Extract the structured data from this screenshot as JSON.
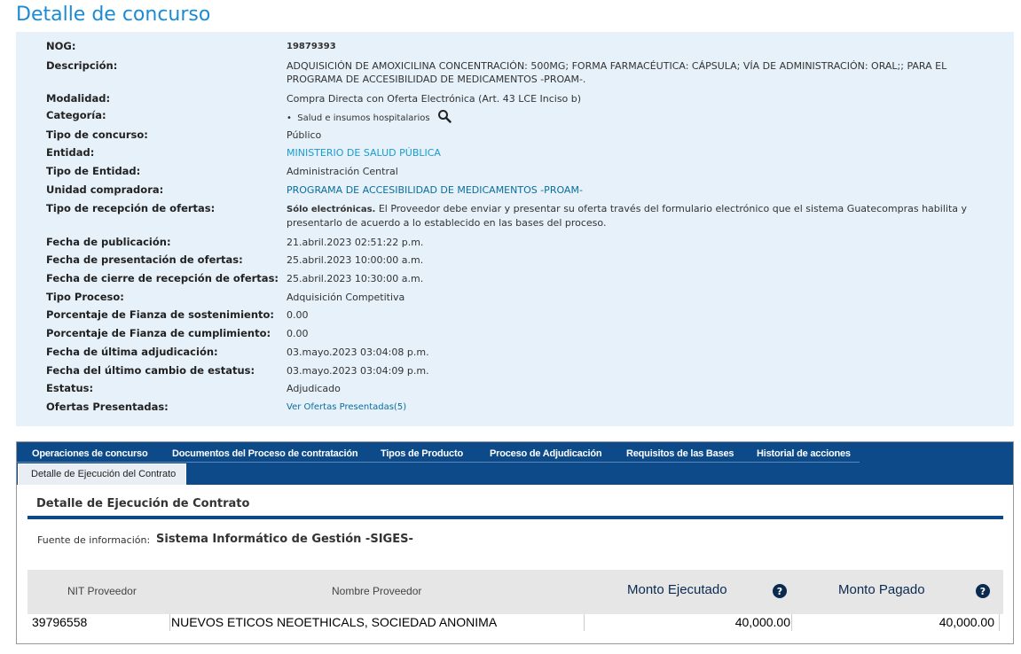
{
  "page_title": "Detalle de concurso",
  "details": [
    {
      "label": "NOG:",
      "value": "19879393"
    },
    {
      "label": "Descripción:",
      "value": "ADQUISICIÓN DE AMOXICILINA CONCENTRACIÓN: 500MG; FORMA FARMACÉUTICA: CÁPSULA; VÍA DE ADMINISTRACIÓN: ORAL;; PARA EL PROGRAMA DE ACCESIBILIDAD DE MEDICAMENTOS -PROAM-."
    },
    {
      "label": "Modalidad:",
      "value": "Compra Directa con Oferta Electrónica (Art. 43 LCE Inciso b)"
    },
    {
      "label": "Categoría:",
      "value": "Salud e insumos hospitalarios"
    },
    {
      "label": "Tipo de concurso:",
      "value": "Público"
    },
    {
      "label": "Entidad:",
      "value": "MINISTERIO DE SALUD PÚBLICA"
    },
    {
      "label": "Tipo de Entidad:",
      "value": "Administración Central"
    },
    {
      "label": "Unidad compradora:",
      "value": "PROGRAMA DE ACCESIBILIDAD DE MEDICAMENTOS -PROAM-"
    },
    {
      "label": "Tipo de recepción de ofertas:",
      "value_lead": "Sólo electrónicas.",
      "value": " El Proveedor debe enviar y presentar su oferta través del formulario electrónico que el sistema Guatecompras habilita y presentarlo de acuerdo a lo establecido en las bases del proceso."
    },
    {
      "label": "Fecha de publicación:",
      "value": "21.abril.2023 02:51:22 p.m."
    },
    {
      "label": "Fecha de presentación de ofertas:",
      "value": "25.abril.2023 10:00:00 a.m."
    },
    {
      "label": "Fecha de cierre de recepción de ofertas:",
      "value": "25.abril.2023 10:30:00 a.m."
    },
    {
      "label": "Tipo Proceso:",
      "value": "Adquisición Competitiva"
    },
    {
      "label": "Porcentaje de Fianza de sostenimiento:",
      "value": "0.00"
    },
    {
      "label": "Porcentaje de Fianza de cumplimiento:",
      "value": "0.00"
    },
    {
      "label": "Fecha de última adjudicación:",
      "value": "03.mayo.2023 03:04:08 p.m."
    },
    {
      "label": "Fecha del último cambio de estatus:",
      "value": "03.mayo.2023 03:04:09 p.m."
    },
    {
      "label": "Estatus:",
      "value": "Adjudicado"
    },
    {
      "label": "Ofertas Presentadas:",
      "value": "Ver Ofertas Presentadas(5)"
    }
  ],
  "tabs": [
    "Operaciones de concurso",
    "Documentos del Proceso de contratación",
    "Tipos de Producto",
    "Proceso de Adjudicación",
    "Requisitos de las Bases",
    "Historial de acciones"
  ],
  "active_tab": "Detalle de Ejecución del Contrato",
  "section_title": "Detalle de Ejecución de Contrato",
  "source_label": "Fuente de información:",
  "source_value": "Sistema Informático de Gestión -SIGES-",
  "grid": {
    "headers": [
      "NIT Proveedor",
      "Nombre Proveedor",
      "Monto Ejecutado",
      "Monto Pagado"
    ],
    "rows": [
      [
        "39796558",
        "NUEVOS ETICOS NEOETHICALS, SOCIEDAD ANONIMA",
        "40,000.00",
        "40,000.00"
      ]
    ]
  },
  "colors": {
    "title": "#1a8bd6",
    "panel": "#e6f1fa",
    "tab_bar": "#0c4a8a",
    "link": "#1a9bd0"
  }
}
